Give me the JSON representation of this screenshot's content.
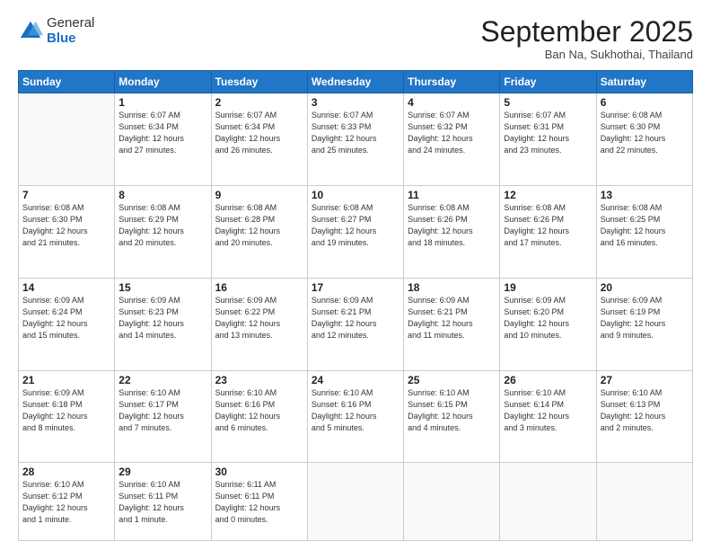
{
  "logo": {
    "general": "General",
    "blue": "Blue"
  },
  "header": {
    "month": "September 2025",
    "location": "Ban Na, Sukhothai, Thailand"
  },
  "weekdays": [
    "Sunday",
    "Monday",
    "Tuesday",
    "Wednesday",
    "Thursday",
    "Friday",
    "Saturday"
  ],
  "weeks": [
    [
      {
        "day": "",
        "info": ""
      },
      {
        "day": "1",
        "info": "Sunrise: 6:07 AM\nSunset: 6:34 PM\nDaylight: 12 hours\nand 27 minutes."
      },
      {
        "day": "2",
        "info": "Sunrise: 6:07 AM\nSunset: 6:34 PM\nDaylight: 12 hours\nand 26 minutes."
      },
      {
        "day": "3",
        "info": "Sunrise: 6:07 AM\nSunset: 6:33 PM\nDaylight: 12 hours\nand 25 minutes."
      },
      {
        "day": "4",
        "info": "Sunrise: 6:07 AM\nSunset: 6:32 PM\nDaylight: 12 hours\nand 24 minutes."
      },
      {
        "day": "5",
        "info": "Sunrise: 6:07 AM\nSunset: 6:31 PM\nDaylight: 12 hours\nand 23 minutes."
      },
      {
        "day": "6",
        "info": "Sunrise: 6:08 AM\nSunset: 6:30 PM\nDaylight: 12 hours\nand 22 minutes."
      }
    ],
    [
      {
        "day": "7",
        "info": "Sunrise: 6:08 AM\nSunset: 6:30 PM\nDaylight: 12 hours\nand 21 minutes."
      },
      {
        "day": "8",
        "info": "Sunrise: 6:08 AM\nSunset: 6:29 PM\nDaylight: 12 hours\nand 20 minutes."
      },
      {
        "day": "9",
        "info": "Sunrise: 6:08 AM\nSunset: 6:28 PM\nDaylight: 12 hours\nand 20 minutes."
      },
      {
        "day": "10",
        "info": "Sunrise: 6:08 AM\nSunset: 6:27 PM\nDaylight: 12 hours\nand 19 minutes."
      },
      {
        "day": "11",
        "info": "Sunrise: 6:08 AM\nSunset: 6:26 PM\nDaylight: 12 hours\nand 18 minutes."
      },
      {
        "day": "12",
        "info": "Sunrise: 6:08 AM\nSunset: 6:26 PM\nDaylight: 12 hours\nand 17 minutes."
      },
      {
        "day": "13",
        "info": "Sunrise: 6:08 AM\nSunset: 6:25 PM\nDaylight: 12 hours\nand 16 minutes."
      }
    ],
    [
      {
        "day": "14",
        "info": "Sunrise: 6:09 AM\nSunset: 6:24 PM\nDaylight: 12 hours\nand 15 minutes."
      },
      {
        "day": "15",
        "info": "Sunrise: 6:09 AM\nSunset: 6:23 PM\nDaylight: 12 hours\nand 14 minutes."
      },
      {
        "day": "16",
        "info": "Sunrise: 6:09 AM\nSunset: 6:22 PM\nDaylight: 12 hours\nand 13 minutes."
      },
      {
        "day": "17",
        "info": "Sunrise: 6:09 AM\nSunset: 6:21 PM\nDaylight: 12 hours\nand 12 minutes."
      },
      {
        "day": "18",
        "info": "Sunrise: 6:09 AM\nSunset: 6:21 PM\nDaylight: 12 hours\nand 11 minutes."
      },
      {
        "day": "19",
        "info": "Sunrise: 6:09 AM\nSunset: 6:20 PM\nDaylight: 12 hours\nand 10 minutes."
      },
      {
        "day": "20",
        "info": "Sunrise: 6:09 AM\nSunset: 6:19 PM\nDaylight: 12 hours\nand 9 minutes."
      }
    ],
    [
      {
        "day": "21",
        "info": "Sunrise: 6:09 AM\nSunset: 6:18 PM\nDaylight: 12 hours\nand 8 minutes."
      },
      {
        "day": "22",
        "info": "Sunrise: 6:10 AM\nSunset: 6:17 PM\nDaylight: 12 hours\nand 7 minutes."
      },
      {
        "day": "23",
        "info": "Sunrise: 6:10 AM\nSunset: 6:16 PM\nDaylight: 12 hours\nand 6 minutes."
      },
      {
        "day": "24",
        "info": "Sunrise: 6:10 AM\nSunset: 6:16 PM\nDaylight: 12 hours\nand 5 minutes."
      },
      {
        "day": "25",
        "info": "Sunrise: 6:10 AM\nSunset: 6:15 PM\nDaylight: 12 hours\nand 4 minutes."
      },
      {
        "day": "26",
        "info": "Sunrise: 6:10 AM\nSunset: 6:14 PM\nDaylight: 12 hours\nand 3 minutes."
      },
      {
        "day": "27",
        "info": "Sunrise: 6:10 AM\nSunset: 6:13 PM\nDaylight: 12 hours\nand 2 minutes."
      }
    ],
    [
      {
        "day": "28",
        "info": "Sunrise: 6:10 AM\nSunset: 6:12 PM\nDaylight: 12 hours\nand 1 minute."
      },
      {
        "day": "29",
        "info": "Sunrise: 6:10 AM\nSunset: 6:11 PM\nDaylight: 12 hours\nand 1 minute."
      },
      {
        "day": "30",
        "info": "Sunrise: 6:11 AM\nSunset: 6:11 PM\nDaylight: 12 hours\nand 0 minutes."
      },
      {
        "day": "",
        "info": ""
      },
      {
        "day": "",
        "info": ""
      },
      {
        "day": "",
        "info": ""
      },
      {
        "day": "",
        "info": ""
      }
    ]
  ]
}
